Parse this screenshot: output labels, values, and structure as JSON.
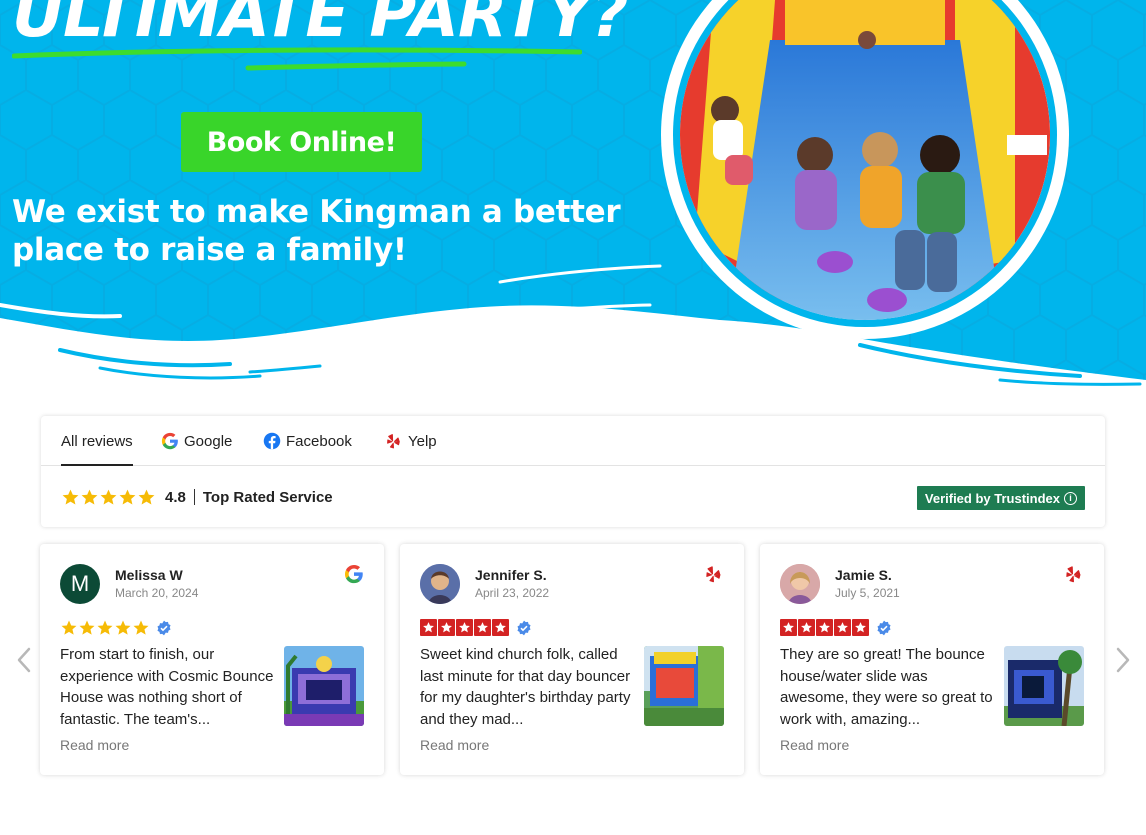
{
  "hero": {
    "title": "ULTIMATE PARTY?",
    "book_button": "Book Online!",
    "subtitle": "We exist to make Kingman a better place to raise a family!",
    "colors": {
      "sky": "#00b5ec",
      "button_green": "#39d52a",
      "underline_green": "#3ddc2e"
    }
  },
  "reviews_header": {
    "tabs": [
      {
        "label": "All reviews",
        "icon": ""
      },
      {
        "label": "Google",
        "icon": "google-icon"
      },
      {
        "label": "Facebook",
        "icon": "facebook-icon"
      },
      {
        "label": "Yelp",
        "icon": "yelp-icon"
      }
    ],
    "rating_score": "4.8",
    "rating_text": "Top Rated Service",
    "verified_label": "Verified by Trustindex",
    "verified_color": "#1e7c52",
    "star_rating": 4.8
  },
  "reviews": [
    {
      "name": "Melissa W",
      "date": "March 20, 2024",
      "source": "google-icon",
      "avatar_letter": "M",
      "avatar_color": "#0c4a36",
      "text": "From start to finish, our experience with Cosmic Bounce House was nothing short of fantastic. The team's...",
      "read_more": "Read more",
      "stars": 5
    },
    {
      "name": "Jennifer S.",
      "date": "April 23, 2022",
      "source": "yelp-icon",
      "avatar_letter": "",
      "avatar_color": "#6b7bb5",
      "text": "Sweet kind church folk, called last minute for that day bouncer for my daughter's birthday party and they mad...",
      "read_more": "Read more",
      "stars": 5
    },
    {
      "name": "Jamie S.",
      "date": "July 5, 2021",
      "source": "yelp-icon",
      "avatar_letter": "",
      "avatar_color": "#c98a8a",
      "text": "They are so great! The bounce house/water slide was awesome, they were so great to work with, amazing...",
      "read_more": "Read more",
      "stars": 5
    }
  ],
  "nav": {
    "prev_icon": "chevron-left-icon",
    "next_icon": "chevron-right-icon"
  }
}
